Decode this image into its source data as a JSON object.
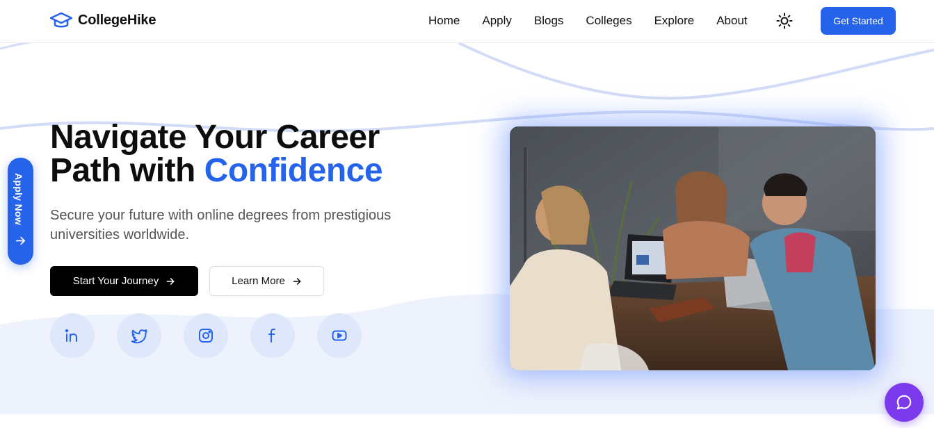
{
  "brand": {
    "name": "CollegeHike",
    "logo_icon": "graduation-cap-icon",
    "accent_color": "#2563eb"
  },
  "nav": {
    "items": [
      {
        "label": "Home"
      },
      {
        "label": "Apply"
      },
      {
        "label": "Blogs"
      },
      {
        "label": "Colleges"
      },
      {
        "label": "Explore"
      },
      {
        "label": "About"
      }
    ],
    "theme_toggle_icon": "sun-icon",
    "cta_label": "Get Started"
  },
  "hero": {
    "title_line1": "Navigate Your Career",
    "title_line2_prefix": "Path with",
    "title_line2_accent": "Confidence",
    "subtitle": "Secure your future with online degrees from prestigious universities worldwide.",
    "primary_button": "Start Your Journey",
    "secondary_button": "Learn More",
    "socials": [
      {
        "icon": "linkedin-icon"
      },
      {
        "icon": "twitter-icon"
      },
      {
        "icon": "instagram-icon"
      },
      {
        "icon": "facebook-icon"
      },
      {
        "icon": "youtube-icon"
      }
    ]
  },
  "side_tab": {
    "label": "Apply Now",
    "icon": "arrow-right-icon"
  },
  "chat": {
    "icon": "chat-bubble-icon",
    "color": "#7c3aed"
  }
}
